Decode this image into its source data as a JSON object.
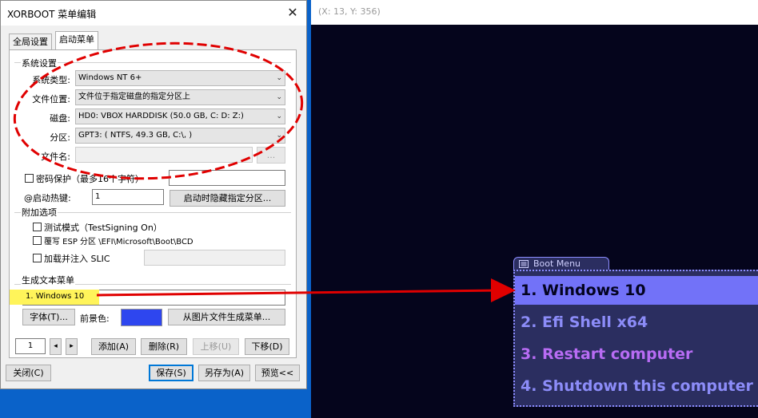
{
  "dialog": {
    "title": "XORBOOT 菜单编辑",
    "close_glyph": "✕",
    "tabs": [
      {
        "label": "全局设置"
      },
      {
        "label": "启动菜单"
      }
    ],
    "system_group": {
      "label": "系统设置",
      "os_type_label": "系统类型:",
      "os_type_value": "Windows NT 6+",
      "file_loc_label": "文件位置:",
      "file_loc_value": "文件位于指定磁盘的指定分区上",
      "disk_label": "磁盘:",
      "disk_value": "HD0: VBOX HARDDISK (50.0 GB, C: D: Z:)",
      "partition_label": "分区:",
      "partition_value": "GPT3: ( NTFS,  49.3 GB, C:\\, )",
      "filename_label": "文件名:",
      "filename_value": "",
      "browse_label": "..."
    },
    "password_label": "密码保护（最多16个字符）",
    "password_value": "",
    "hotkey_label": "@启动热键:",
    "hotkey_value": "1",
    "hide_partition_button": "启动时隐藏指定分区...",
    "extra_group": {
      "label": "附加选项",
      "testsigning_label": "测试模式（TestSigning On）",
      "esp_label": "覆写 ESP 分区 \\EFI\\Microsoft\\Boot\\BCD",
      "slic_label": "加载并注入 SLIC",
      "slic_value": ""
    },
    "textmenu_group": {
      "label": "生成文本菜单",
      "item_value": "1. Windows 10",
      "font_button": "字体(T)...",
      "fg_label": "前景色:",
      "fg_color": "#2e46ef",
      "from_image_button": "从图片文件生成菜单..."
    },
    "nav": {
      "index_value": "1",
      "prev_glyph": "◂",
      "next_glyph": "▸",
      "add": "添加(A)",
      "delete": "删除(R)",
      "up": "上移(U)",
      "down": "下移(D)"
    },
    "footer": {
      "close": "关闭(C)",
      "save": "保存(S)",
      "save_as": "另存为(A)",
      "preview": "预览<<"
    }
  },
  "preview": {
    "coords": "(X: 13, Y: 356)",
    "boot_menu": {
      "title": "Boot Menu",
      "items": [
        {
          "label": "1.  Windows 10",
          "color": "#040420",
          "selected": true
        },
        {
          "label": "2.  Efi Shell x64",
          "color": "#8c8cf8",
          "selected": false
        },
        {
          "label": "3.  Restart computer",
          "color": "#b86cf4",
          "selected": false
        },
        {
          "label": "4.  Shutdown this computer",
          "color": "#8c8cf8",
          "selected": false
        }
      ]
    }
  },
  "annotations": {
    "ellipse_color": "#e00000",
    "arrow_color": "#e00000",
    "highlight_color": "#fff45a"
  }
}
